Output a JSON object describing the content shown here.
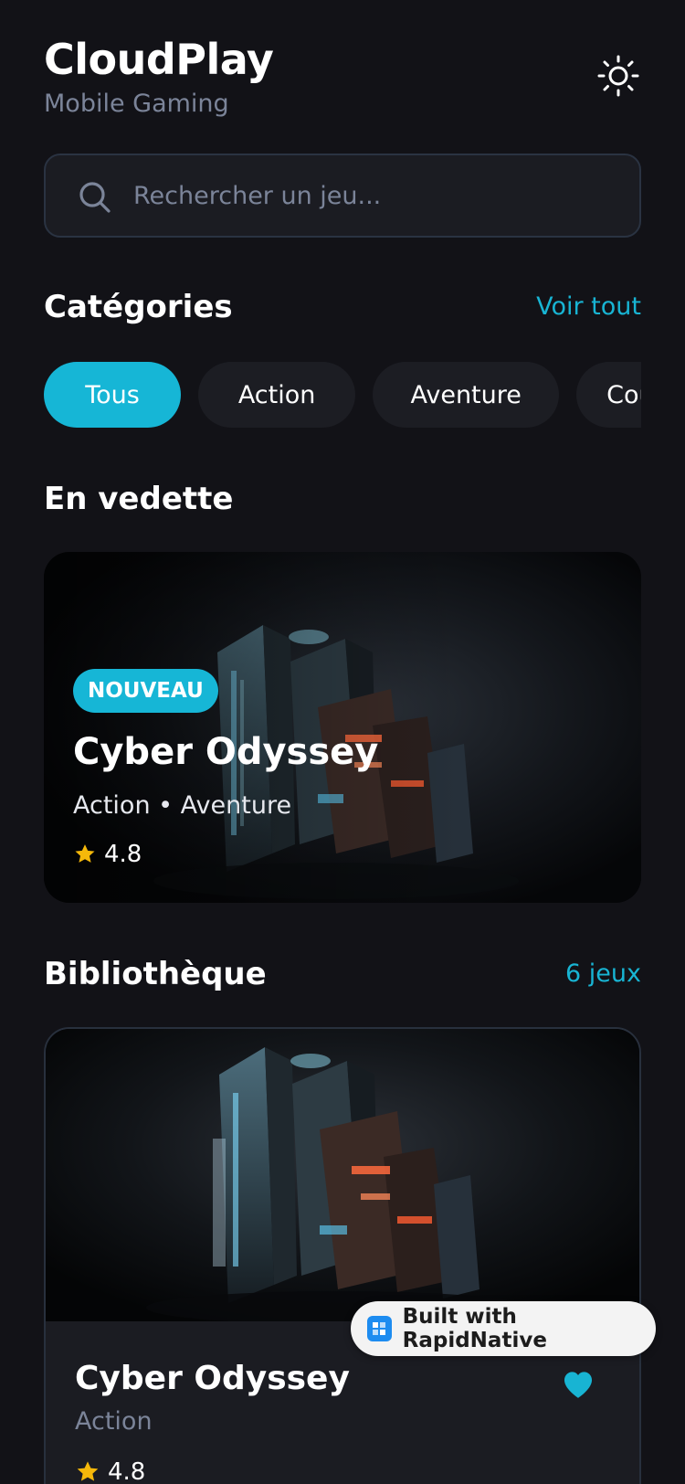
{
  "header": {
    "title": "CloudPlay",
    "subtitle": "Mobile Gaming",
    "theme_icon": "sun-icon"
  },
  "search": {
    "placeholder": "Rechercher un jeu...",
    "value": ""
  },
  "categories": {
    "title": "Catégories",
    "link": "Voir tout",
    "chips": [
      {
        "label": "Tous",
        "active": true
      },
      {
        "label": "Action",
        "active": false
      },
      {
        "label": "Aventure",
        "active": false
      },
      {
        "label": "Course",
        "active": false
      }
    ]
  },
  "featured": {
    "title": "En vedette",
    "card": {
      "badge": "NOUVEAU",
      "game_title": "Cyber Odyssey",
      "genres": "Action • Aventure",
      "rating": "4.8"
    }
  },
  "library": {
    "title": "Bibliothèque",
    "count": "6 jeux",
    "items": [
      {
        "title": "Cyber Odyssey",
        "genre": "Action",
        "rating": "4.8",
        "favorite": true
      }
    ]
  },
  "built_with": {
    "label": "Built with RapidNative"
  },
  "colors": {
    "background": "#121217",
    "accent": "#16b6d6",
    "card": "#1b1c22",
    "muted_text": "#7b8499",
    "star": "#f5b80a"
  }
}
